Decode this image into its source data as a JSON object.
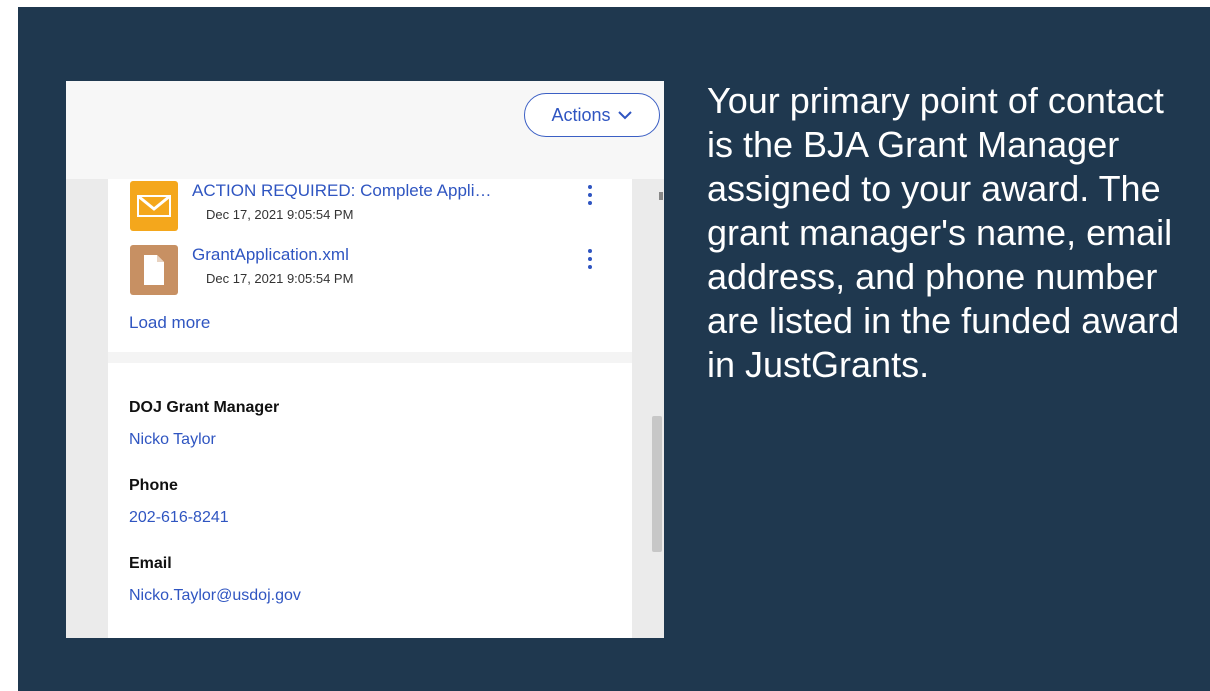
{
  "screenshot": {
    "actions_label": "Actions",
    "files": [
      {
        "title": "ACTION REQUIRED: Complete Appli…",
        "date": "Dec 17, 2021 9:05:54 PM",
        "icon": "mail-icon"
      },
      {
        "title": "GrantApplication.xml",
        "date": "Dec 17, 2021 9:05:54 PM",
        "icon": "document-icon"
      }
    ],
    "load_more": "Load more",
    "contact": {
      "manager_label": "DOJ Grant Manager",
      "manager_name": "Nicko Taylor",
      "phone_label": "Phone",
      "phone": "202-616-8241",
      "email_label": "Email",
      "email": "Nicko.Taylor@usdoj.gov"
    }
  },
  "caption": "Your primary point of contact is the BJA Grant Manager assigned to your award. The grant manager's name, email address, and phone number are listed in the funded award in JustGrants.",
  "colors": {
    "slide_background": "#1f384f",
    "link": "#2f55c1",
    "mail_icon": "#f4a71c",
    "document_icon": "#c79063"
  }
}
